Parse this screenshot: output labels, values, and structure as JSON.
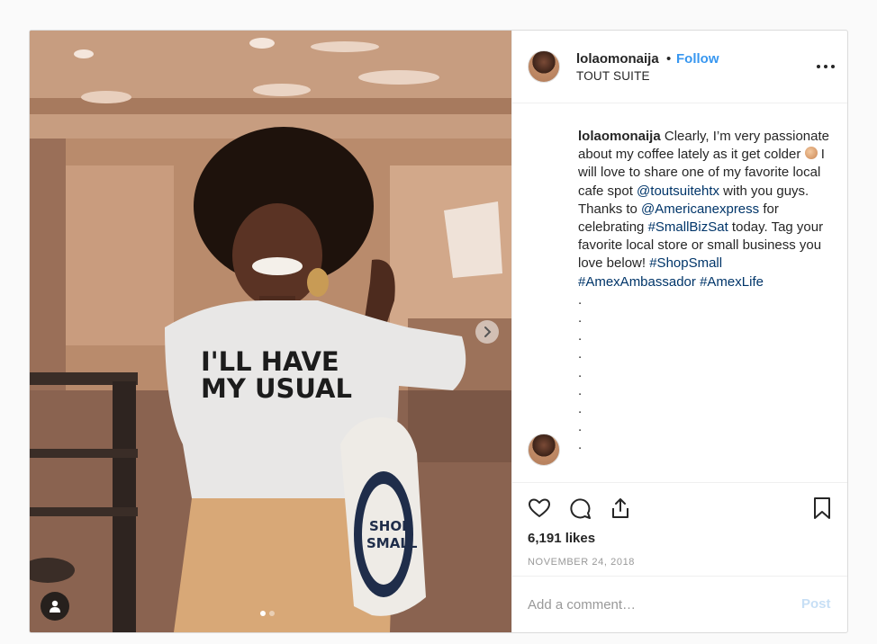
{
  "post": {
    "username": "lolaomonaija",
    "bullet": "•",
    "follow_label": "Follow",
    "location": "TOUT SUITE",
    "more_icon": "more-horizontal-icon",
    "image": {
      "shirt_text_line1": "I'LL HAVE",
      "shirt_text_line2": "MY USUAL",
      "bag_text_line1": "SHOP",
      "bag_text_line2": "SMALL",
      "carousel_total": 2,
      "carousel_current": 1
    },
    "caption": {
      "username": "lolaomonaija",
      "text_1": " Clearly, I’m very passionate about my coffee lately as it get colder ",
      "text_2": "  I will love to share one of my favorite local cafe spot ",
      "mention_1": "@toutsuitehtx",
      "text_3": " with you guys. Thanks to ",
      "mention_2": "@Americanexpress",
      "text_4": " for celebrating ",
      "hashtag_1": "#SmallBizSat",
      "text_5": " today. Tag your favorite local store or small business you love below! ",
      "hashtag_2": "#ShopSmall",
      "hashtag_3": "#AmexAmbassador",
      "hashtag_4": "#AmexLife",
      "dot": "."
    },
    "likes": "6,191 likes",
    "date": "NOVEMBER 24, 2018",
    "comment_placeholder": "Add a comment…",
    "post_button": "Post"
  },
  "colors": {
    "link": "#003569",
    "follow": "#3897f0",
    "muted": "#999999",
    "post_disabled": "#c7dff5"
  }
}
